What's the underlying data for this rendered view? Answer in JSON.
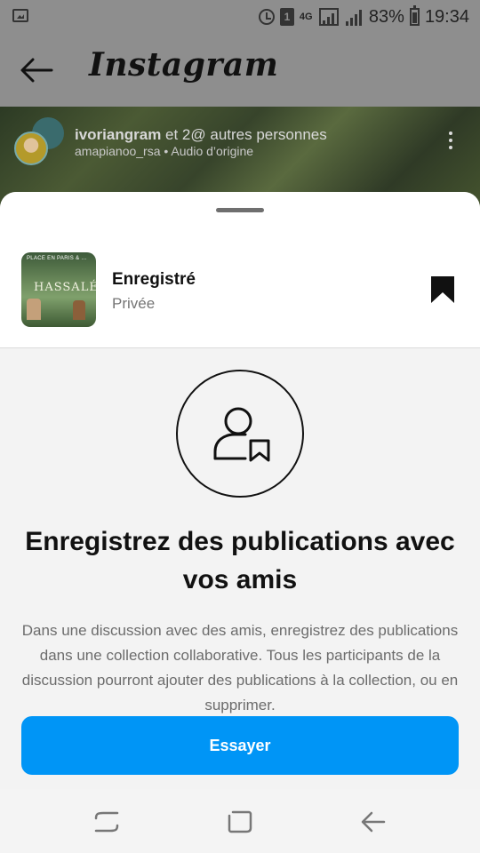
{
  "status_bar": {
    "network": "4G",
    "sim_slot": "1",
    "battery": "83%",
    "time": "19:34",
    "icons": [
      "image-icon",
      "alarm-icon",
      "sim-icon",
      "signal-icon",
      "signal-icon",
      "battery-icon"
    ]
  },
  "header": {
    "brand": "Instagram",
    "back_icon": "arrow-left-icon"
  },
  "post": {
    "user_primary": "ivoriangram",
    "user_suffix": " et 2@ autres personnes",
    "audio": "amapianoo_rsa • Audio d’origine",
    "more_icon": "more-vertical-icon"
  },
  "sheet": {
    "collection_title": "Enregistré",
    "collection_privacy": "Privée",
    "thumbnail_top": "PLACE EN PARIS & …",
    "thumbnail_title": "HASSALÉ",
    "bookmark_icon": "bookmark-icon",
    "illustration_icon": "user-bookmark-icon",
    "heading": "Enregistrez des publications avec vos amis",
    "body": "Dans une discussion avec des amis, enregistrez des publications dans une collection collaborative. Tous les participants de la discussion pourront ajouter des publications à la collection, ou en supprimer.",
    "cta_label": "Essayer"
  },
  "nav": {
    "recent_icon": "recent-apps-icon",
    "home_icon": "home-icon",
    "back_icon": "back-icon"
  },
  "colors": {
    "accent": "#0095f6",
    "scrim": "#8e8e8e",
    "sheet_bg": "#f3f3f3"
  }
}
